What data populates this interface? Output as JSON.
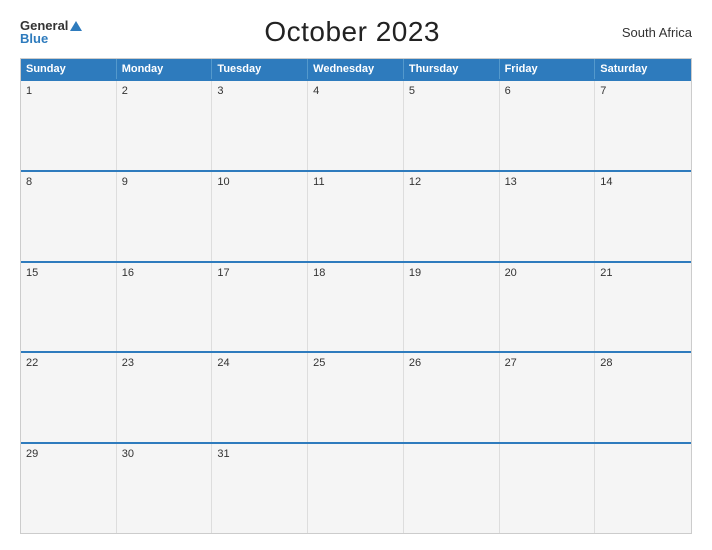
{
  "header": {
    "logo_general": "General",
    "logo_blue": "Blue",
    "title": "October 2023",
    "country": "South Africa"
  },
  "calendar": {
    "days_of_week": [
      "Sunday",
      "Monday",
      "Tuesday",
      "Wednesday",
      "Thursday",
      "Friday",
      "Saturday"
    ],
    "weeks": [
      [
        {
          "day": "1",
          "empty": false
        },
        {
          "day": "2",
          "empty": false
        },
        {
          "day": "3",
          "empty": false
        },
        {
          "day": "4",
          "empty": false
        },
        {
          "day": "5",
          "empty": false
        },
        {
          "day": "6",
          "empty": false
        },
        {
          "day": "7",
          "empty": false
        }
      ],
      [
        {
          "day": "8",
          "empty": false
        },
        {
          "day": "9",
          "empty": false
        },
        {
          "day": "10",
          "empty": false
        },
        {
          "day": "11",
          "empty": false
        },
        {
          "day": "12",
          "empty": false
        },
        {
          "day": "13",
          "empty": false
        },
        {
          "day": "14",
          "empty": false
        }
      ],
      [
        {
          "day": "15",
          "empty": false
        },
        {
          "day": "16",
          "empty": false
        },
        {
          "day": "17",
          "empty": false
        },
        {
          "day": "18",
          "empty": false
        },
        {
          "day": "19",
          "empty": false
        },
        {
          "day": "20",
          "empty": false
        },
        {
          "day": "21",
          "empty": false
        }
      ],
      [
        {
          "day": "22",
          "empty": false
        },
        {
          "day": "23",
          "empty": false
        },
        {
          "day": "24",
          "empty": false
        },
        {
          "day": "25",
          "empty": false
        },
        {
          "day": "26",
          "empty": false
        },
        {
          "day": "27",
          "empty": false
        },
        {
          "day": "28",
          "empty": false
        }
      ],
      [
        {
          "day": "29",
          "empty": false
        },
        {
          "day": "30",
          "empty": false
        },
        {
          "day": "31",
          "empty": false
        },
        {
          "day": "",
          "empty": true
        },
        {
          "day": "",
          "empty": true
        },
        {
          "day": "",
          "empty": true
        },
        {
          "day": "",
          "empty": true
        }
      ]
    ]
  }
}
